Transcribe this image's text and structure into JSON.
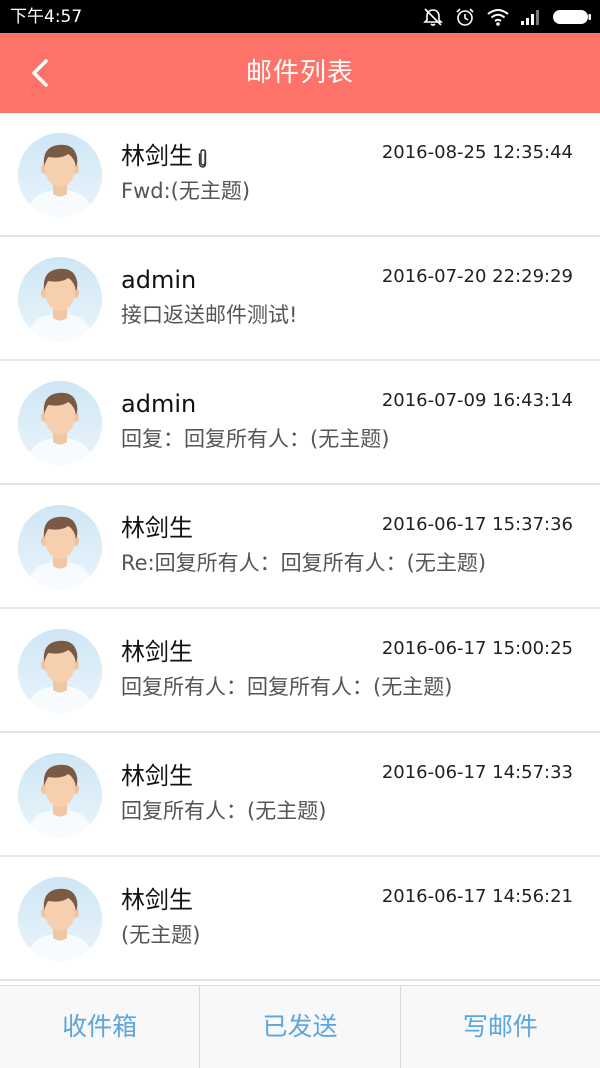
{
  "status_bar": {
    "time": "下午4:57",
    "icons": [
      "alarm-off-icon",
      "alarm-clock-icon",
      "wifi-icon",
      "signal-icon",
      "battery-icon"
    ]
  },
  "header": {
    "title": "邮件列表",
    "back_icon": "chevron-left-icon",
    "background": "#fd7369"
  },
  "mails": [
    {
      "sender": "林剑生",
      "date": "2016-08-25 12:35:44",
      "subject": "Fwd:(无主题)",
      "has_attachment": true
    },
    {
      "sender": "admin",
      "date": "2016-07-20 22:29:29",
      "subject": "接口返送邮件测试!",
      "has_attachment": false
    },
    {
      "sender": "admin",
      "date": "2016-07-09 16:43:14",
      "subject": "回复：回复所有人：(无主题)",
      "has_attachment": false
    },
    {
      "sender": "林剑生",
      "date": "2016-06-17 15:37:36",
      "subject": "Re:回复所有人：回复所有人：(无主题)",
      "has_attachment": false
    },
    {
      "sender": "林剑生",
      "date": "2016-06-17 15:00:25",
      "subject": "回复所有人：回复所有人：(无主题)",
      "has_attachment": false
    },
    {
      "sender": "林剑生",
      "date": "2016-06-17 14:57:33",
      "subject": "回复所有人：(无主题)",
      "has_attachment": false
    },
    {
      "sender": "林剑生",
      "date": "2016-06-17 14:56:21",
      "subject": "(无主题)",
      "has_attachment": false
    }
  ],
  "tabs": [
    {
      "label": "收件箱"
    },
    {
      "label": "已发送"
    },
    {
      "label": "写邮件"
    }
  ],
  "colors": {
    "accent": "#fd7369",
    "tab_text": "#5ba6e0"
  }
}
